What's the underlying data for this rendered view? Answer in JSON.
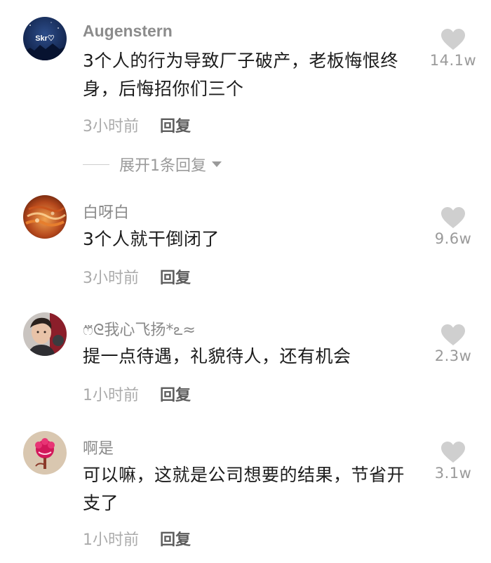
{
  "comments": [
    {
      "username": "Augenstern",
      "avatar_text": "Skr♡",
      "text": "3个人的行为导致厂子破产，老板悔恨终身，后悔招你们三个",
      "time": "3小时前",
      "reply_label": "回复",
      "likes": "14.1w",
      "expand_label": "展开1条回复"
    },
    {
      "username": "白呀白",
      "text": "3个人就干倒闭了",
      "time": "3小时前",
      "reply_label": "回复",
      "likes": "9.6w"
    },
    {
      "username": "ෆ⃛ᘓ我心飞扬*ఽ≈",
      "text": "提一点待遇，礼貌待人，还有机会",
      "time": "1小时前",
      "reply_label": "回复",
      "likes": "2.3w"
    },
    {
      "username": "啊是",
      "text": "可以嘛，这就是公司想要的结果，节省开支了",
      "time": "1小时前",
      "reply_label": "回复",
      "likes": "3.1w"
    }
  ],
  "colors": {
    "like_icon": "#cfcfcf",
    "username": "#8a8a8a",
    "meta_time": "#ababab",
    "reply": "#5d5d5d"
  },
  "icons": {
    "like": "heart-icon",
    "expand": "caret-down-icon"
  }
}
